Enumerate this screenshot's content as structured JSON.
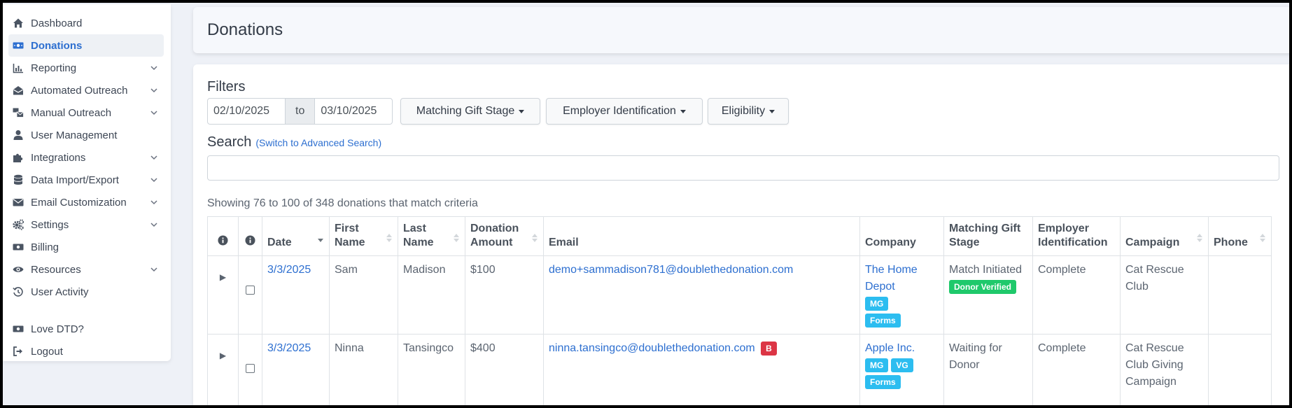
{
  "sidebar": {
    "items": [
      {
        "label": "Dashboard",
        "icon": "home-icon"
      },
      {
        "label": "Donations",
        "icon": "money-bill-icon",
        "active": true
      },
      {
        "label": "Reporting",
        "icon": "chart-bar-icon",
        "expandable": true
      },
      {
        "label": "Automated Outreach",
        "icon": "envelope-open-icon",
        "expandable": true
      },
      {
        "label": "Manual Outreach",
        "icon": "mail-bulk-icon",
        "expandable": true
      },
      {
        "label": "User Management",
        "icon": "user-icon"
      },
      {
        "label": "Integrations",
        "icon": "puzzle-piece-icon",
        "expandable": true
      },
      {
        "label": "Data Import/Export",
        "icon": "database-icon",
        "expandable": true
      },
      {
        "label": "Email Customization",
        "icon": "envelope-icon",
        "expandable": true
      },
      {
        "label": "Settings",
        "icon": "cogs-icon",
        "expandable": true
      },
      {
        "label": "Billing",
        "icon": "money-bill-icon"
      },
      {
        "label": "Resources",
        "icon": "eye-icon",
        "expandable": true
      },
      {
        "label": "User Activity",
        "icon": "history-icon"
      }
    ],
    "footer": [
      {
        "label": "Love DTD?",
        "icon": "money-bill-icon"
      },
      {
        "label": "Logout",
        "icon": "sign-out-icon"
      }
    ]
  },
  "header": {
    "title": "Donations"
  },
  "filters": {
    "title": "Filters",
    "date_from": "02/10/2025",
    "date_to_label": "to",
    "date_to": "03/10/2025",
    "matching_gift_stage": "Matching Gift Stage",
    "employer_identification": "Employer Identification",
    "eligibility": "Eligibility"
  },
  "search": {
    "title": "Search",
    "advanced_link": "(Switch to Advanced Search)",
    "value": ""
  },
  "results": {
    "summary": "Showing 76 to 100 of 348 donations that match criteria"
  },
  "table": {
    "columns": {
      "date": "Date",
      "first_name": "First Name",
      "last_name": "Last Name",
      "donation_amount": "Donation Amount",
      "email": "Email",
      "company": "Company",
      "matching_gift_stage": "Matching Gift Stage",
      "employer_identification": "Employer Identification",
      "campaign": "Campaign",
      "phone": "Phone"
    },
    "rows": [
      {
        "date": "3/3/2025",
        "first_name": "Sam",
        "last_name": "Madison",
        "amount": "$100",
        "email": "demo+sammadison781@doublethedonation.com",
        "company": "The Home Depot",
        "company_badges": [
          "MG",
          "Forms"
        ],
        "stage": "Match Initiated",
        "stage_badge": "Donor Verified",
        "employer_identification": "Complete",
        "campaign": "Cat Rescue Club",
        "phone": ""
      },
      {
        "date": "3/3/2025",
        "first_name": "Ninna",
        "last_name": "Tansingco",
        "amount": "$400",
        "email": "ninna.tansingco@doublethedonation.com",
        "email_badge": "B",
        "company": "Apple Inc.",
        "company_badges": [
          "MG",
          "VG",
          "Forms"
        ],
        "stage": "Waiting for Donor",
        "employer_identification": "Complete",
        "campaign": "Cat Rescue Club Giving Campaign",
        "phone": ""
      }
    ]
  },
  "colors": {
    "accent": "#2d6fd0",
    "badge_info": "#2cbdf0",
    "badge_success": "#1fc96b",
    "badge_danger": "#dc3545"
  }
}
